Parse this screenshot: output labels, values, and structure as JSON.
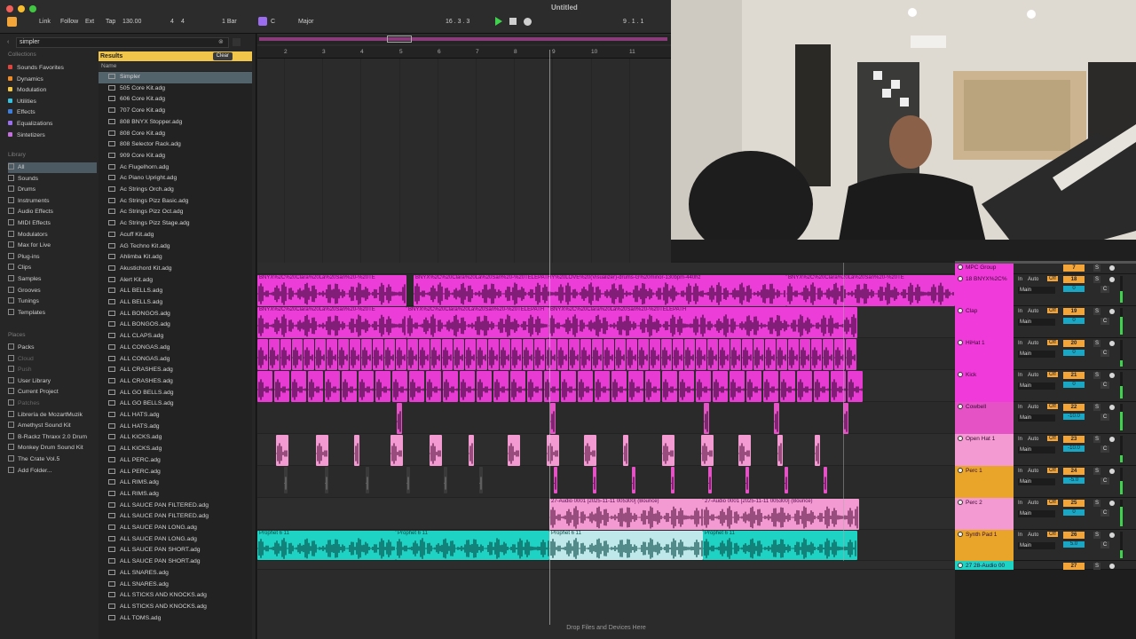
{
  "app": {
    "title": "Untitled"
  },
  "transport": {
    "link": "Link",
    "follow": "Follow",
    "ext": "Ext",
    "tap": "Tap",
    "tempo": "130.00",
    "sig_num": "4",
    "sig_den": "4",
    "quant": "1 Bar",
    "key": "C",
    "scale": "Major",
    "position": "16 . 3 . 3",
    "loop_pos": "9 . 1 . 1"
  },
  "browser": {
    "search_value": "simpler",
    "collections_title": "Collections",
    "collections": [
      {
        "label": "Sounds Favorites",
        "color": "#e0443c"
      },
      {
        "label": "Dynamics",
        "color": "#f08a24"
      },
      {
        "label": "Modulation",
        "color": "#f3c645"
      },
      {
        "label": "Utilities",
        "color": "#37c0e0"
      },
      {
        "label": "Effects",
        "color": "#3b7fe0"
      },
      {
        "label": "Equalizations",
        "color": "#9a6ff0"
      },
      {
        "label": "Sintetizers",
        "color": "#c56fe0"
      }
    ],
    "library_title": "Library",
    "library": [
      "All",
      "Sounds",
      "Drums",
      "Instruments",
      "Audio Effects",
      "MIDI Effects",
      "Modulators",
      "Max for Live",
      "Plug-ins",
      "Clips",
      "Samples",
      "Grooves",
      "Tunings",
      "Templates"
    ],
    "places_title": "Places",
    "places": [
      "Packs",
      "Cloud",
      "Push",
      "User Library",
      "Current Project",
      "Patches",
      "Librería de MozartMuzik",
      "Amethyst Sound Kit",
      "B-Rackz Thraxx 2.0 Drum",
      "Monkey Drum Sound Kit",
      "The Crate Vol.5",
      "Add Folder..."
    ],
    "results_label": "Results",
    "clear_label": "Clear",
    "name_header": "Name",
    "results": [
      "Simpler",
      "505 Core Kit.adg",
      "606 Core Kit.adg",
      "707 Core Kit.adg",
      "808 BNYX Stopper.adg",
      "808 Core Kit.adg",
      "808 Selector Rack.adg",
      "909 Core Kit.adg",
      "Ac Flugelhorn.adg",
      "Ac Piano Upright.adg",
      "Ac Strings Orch.adg",
      "Ac Strings Pizz Basic.adg",
      "Ac Strings Pizz Oct.adg",
      "Ac Strings Pizz Stage.adg",
      "Acuff Kit.adg",
      "AG Techno Kit.adg",
      "Ahlimba Kit.adg",
      "Akustichord Kit.adg",
      "Alert Kit.adg",
      "ALL BELLS.adg",
      "ALL BELLS.adg",
      "ALL BONGOS.adg",
      "ALL BONGOS.adg",
      "ALL CLAPS.adg",
      "ALL CONGAS.adg",
      "ALL CONGAS.adg",
      "ALL CRASHES.adg",
      "ALL CRASHES.adg",
      "ALL GO BELLS.adg",
      "ALL GO BELLS.adg",
      "ALL HATS.adg",
      "ALL HATS.adg",
      "ALL KICKS.adg",
      "ALL KICKS.adg",
      "ALL PERC.adg",
      "ALL PERC.adg",
      "ALL RIMS.adg",
      "ALL RIMS.adg",
      "ALL SAUCE PAN FILTERED.adg",
      "ALL SAUCE PAN FILTERED.adg",
      "ALL SAUCE PAN LONG.adg",
      "ALL SAUCE PAN LONG.adg",
      "ALL SAUCE PAN SHORT.adg",
      "ALL SAUCE PAN SHORT.adg",
      "ALL SNARES.adg",
      "ALL SNARES.adg",
      "ALL STICKS AND KNOCKS.adg",
      "ALL STICKS AND KNOCKS.adg",
      "ALL TOMS.adg"
    ]
  },
  "ruler": [
    "2",
    "3",
    "4",
    "5",
    "6",
    "7",
    "8",
    "9",
    "10",
    "11"
  ],
  "clips": {
    "drums_a": "BNYX%2C%20Clara%20La%20San%20-%20TE",
    "drums_b": "BNYX%2C%20Clara%20La%20San%20-%20TELEPATHY%20LOVE%20(Visualizer)-drums-G%20minor-130bpm-440hz",
    "drums_c": "BNYX%2C%20Clara%20La%20San%20-%20TE",
    "drums2_a": "BNYX%2C%20Clara%20La%20San%20-%20TE",
    "drums2_b": "BNYX%2C%20Clara%20La%20San%20-%20TELEPATH",
    "drums2_c": "BNYX%2C%20Clara%20La%20San%20-%20TELEPATH",
    "audio_a": "27-Audio 0001 [2025-11-11 005300] (Bounce)",
    "audio_b": "27-Audio 0001 [2025-11-11 005300] (Bounce)",
    "prophet": "Prophet 6 11"
  },
  "tracks": [
    {
      "name": "MPC Group",
      "num": "7",
      "color": "#f03ad9",
      "vol": "",
      "extra": ""
    },
    {
      "name": "18 BNYX%2C%",
      "num": "18",
      "color": "#f03ad9",
      "vol": "0",
      "extra": ""
    },
    {
      "name": "Clap",
      "num": "19",
      "color": "#f03ad9",
      "vol": "0",
      "extra": ""
    },
    {
      "name": "HiHat 1",
      "num": "20",
      "color": "#f03ad9",
      "vol": "0",
      "extra": ""
    },
    {
      "name": "Kick",
      "num": "21",
      "color": "#f03ad9",
      "vol": "0",
      "extra": ""
    },
    {
      "name": "Cowbell",
      "num": "22",
      "color": "#e452c6",
      "vol": "-10.0",
      "extra": ""
    },
    {
      "name": "Open Hat 1",
      "num": "23",
      "color": "#f49ad2",
      "vol": "-10.0",
      "extra": ""
    },
    {
      "name": "Perc 1",
      "num": "24",
      "color": "#e8a52a",
      "vol": "-5.0",
      "extra": ""
    },
    {
      "name": "Perc 2",
      "num": "25",
      "color": "#f49ad2",
      "vol": "0",
      "extra": ""
    },
    {
      "name": "Synth Pad 1",
      "num": "26",
      "color": "#e8a52a",
      "vol": "5.0",
      "extra": ""
    },
    {
      "name": "27 28-Audio 00",
      "num": "27",
      "color": "#1fd3c4",
      "vol": "",
      "extra": ""
    }
  ],
  "mixer": {
    "in": "In",
    "auto": "Auto",
    "off": "Off",
    "main": "Main",
    "s": "S",
    "c": "C"
  },
  "dropzone": "Drop Files and Devices Here"
}
